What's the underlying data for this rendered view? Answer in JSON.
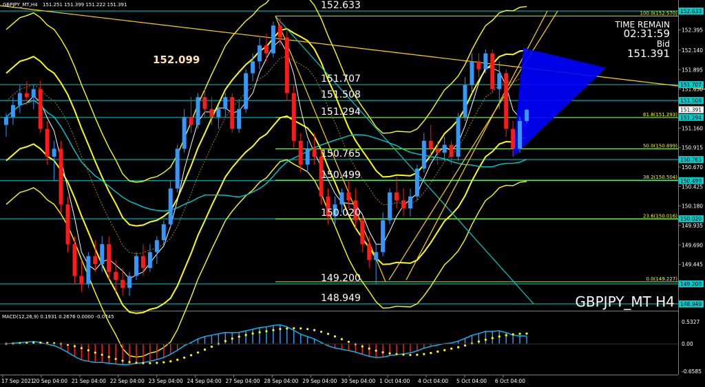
{
  "header": {
    "symbol_tf": "GBPJPY_MT,H4",
    "ohlc": "151.251 151.399 151.222 151.391"
  },
  "info": {
    "time_remain_label": "TIME REMAIN",
    "time_remain": "02:31:59",
    "bid_label": "Bid",
    "bid": "151.391",
    "watermark": "GBPJPY_MT H4",
    "note_value": "152.099"
  },
  "macd": {
    "label": "MACD(12,26,9) 0.1931 0.2676 0.0000 -0.0745",
    "ticks": [
      "0.5327",
      "0.00",
      "-0.6585"
    ],
    "tick_values": [
      0.5327,
      0.0,
      -0.6585
    ]
  },
  "time_labels": [
    "17 Sep 2021",
    "20 Sep 04:00",
    "21 Sep 04:00",
    "22 Sep 04:00",
    "23 Sep 04:00",
    "24 Sep 04:00",
    "27 Sep 04:00",
    "28 Sep 04:00",
    "29 Sep 04:00",
    "30 Sep 04:00",
    "1 Oct 04:00",
    "4 Oct 04:00",
    "5 Oct 04:00",
    "6 Oct 04:00"
  ],
  "price_axis": {
    "labels": [
      "152.395",
      "152.140",
      "151.895",
      "151.650",
      "151.405",
      "151.160",
      "150.915",
      "150.670",
      "150.425",
      "150.180",
      "149.935",
      "149.690",
      "149.445",
      "149.200"
    ],
    "box_labels": [
      "152.633",
      "151.707",
      "151.508",
      "151.391",
      "151.294",
      "150.765",
      "150.499",
      "150.020",
      "149.200",
      "148.949"
    ]
  },
  "levels": [
    {
      "price": 152.633,
      "label": "152.633"
    },
    {
      "price": 151.707,
      "label": "151.707"
    },
    {
      "price": 151.508,
      "label": "151.508"
    },
    {
      "price": 151.294,
      "label": "151.294"
    },
    {
      "price": 150.765,
      "label": "150.765"
    },
    {
      "price": 150.499,
      "label": "150.499"
    },
    {
      "price": 150.02,
      "label": "150.020"
    },
    {
      "price": 149.2,
      "label": "149.200"
    },
    {
      "price": 148.949,
      "label": "148.949"
    }
  ],
  "fib_levels": [
    {
      "price": 152.57,
      "label": "100.0(152.570)"
    },
    {
      "price": 151.293,
      "label": "61.8(151.293)"
    },
    {
      "price": 150.899,
      "label": "50.0(150.899)"
    },
    {
      "price": 150.504,
      "label": "38.2(150.504)"
    },
    {
      "price": 150.016,
      "label": "23.6(150.016)"
    },
    {
      "price": 149.227,
      "label": "0.0(149.227)"
    }
  ],
  "colors": {
    "background": "#000000",
    "bull": "#3399ff",
    "bear": "#ff1a1a",
    "band": "#ffff00",
    "level_line": "#00cccc",
    "fib_line": "#99ff33",
    "triangle": "#0000ff",
    "macd_signal": "#ffff00",
    "macd_line": "#00bfff"
  },
  "chart_data": {
    "type": "candlestick",
    "symbol": "GBPJPY_MT",
    "timeframe": "H4",
    "ylim": [
      148.949,
      152.633
    ],
    "candles": [
      [
        151.2,
        151.35,
        151.05,
        151.3
      ],
      [
        151.3,
        151.55,
        151.2,
        151.45
      ],
      [
        151.45,
        151.7,
        151.35,
        151.6
      ],
      [
        151.6,
        151.75,
        151.45,
        151.55
      ],
      [
        151.55,
        151.7,
        151.4,
        151.65
      ],
      [
        151.65,
        151.75,
        151.1,
        151.15
      ],
      [
        151.15,
        151.25,
        150.7,
        150.8
      ],
      [
        150.8,
        151.0,
        150.5,
        150.9
      ],
      [
        150.9,
        151.0,
        150.1,
        150.2
      ],
      [
        150.2,
        150.3,
        149.6,
        149.7
      ],
      [
        149.7,
        149.8,
        149.2,
        149.3
      ],
      [
        149.3,
        149.5,
        149.1,
        149.2
      ],
      [
        149.2,
        149.6,
        149.15,
        149.55
      ],
      [
        149.55,
        149.75,
        149.35,
        149.45
      ],
      [
        149.45,
        149.8,
        149.35,
        149.7
      ],
      [
        149.7,
        149.8,
        149.25,
        149.35
      ],
      [
        149.35,
        149.5,
        149.1,
        149.25
      ],
      [
        149.25,
        149.4,
        149.05,
        149.15
      ],
      [
        149.15,
        149.35,
        149.05,
        149.3
      ],
      [
        149.3,
        149.6,
        149.25,
        149.55
      ],
      [
        149.55,
        149.7,
        149.3,
        149.4
      ],
      [
        149.4,
        149.7,
        149.35,
        149.6
      ],
      [
        149.6,
        149.8,
        149.45,
        149.75
      ],
      [
        149.75,
        150.0,
        149.7,
        149.95
      ],
      [
        149.95,
        150.5,
        149.9,
        150.4
      ],
      [
        150.4,
        150.95,
        150.35,
        150.9
      ],
      [
        150.9,
        151.4,
        150.85,
        151.3
      ],
      [
        151.3,
        151.55,
        151.1,
        151.2
      ],
      [
        151.2,
        151.6,
        151.15,
        151.55
      ],
      [
        151.55,
        151.65,
        151.3,
        151.4
      ],
      [
        151.4,
        151.55,
        151.2,
        151.3
      ],
      [
        151.3,
        151.45,
        151.15,
        151.4
      ],
      [
        151.4,
        151.6,
        151.3,
        151.55
      ],
      [
        151.55,
        151.6,
        151.1,
        151.15
      ],
      [
        151.15,
        151.5,
        151.1,
        151.4
      ],
      [
        151.4,
        151.9,
        151.35,
        151.85
      ],
      [
        151.85,
        152.1,
        151.75,
        152.0
      ],
      [
        152.0,
        152.3,
        151.9,
        152.2
      ],
      [
        152.2,
        152.35,
        152.0,
        152.1
      ],
      [
        152.1,
        152.5,
        152.05,
        152.45
      ],
      [
        152.45,
        152.55,
        152.2,
        152.3
      ],
      [
        152.3,
        152.4,
        151.5,
        151.6
      ],
      [
        151.6,
        151.7,
        150.9,
        151.0
      ],
      [
        151.0,
        151.1,
        150.6,
        150.7
      ],
      [
        150.7,
        151.0,
        150.6,
        150.9
      ],
      [
        150.9,
        151.1,
        150.7,
        150.8
      ],
      [
        150.8,
        150.9,
        150.2,
        150.3
      ],
      [
        150.3,
        150.4,
        149.95,
        150.05
      ],
      [
        150.05,
        150.3,
        149.95,
        150.2
      ],
      [
        150.2,
        150.4,
        150.1,
        150.35
      ],
      [
        150.35,
        150.5,
        150.15,
        150.25
      ],
      [
        150.25,
        150.4,
        149.9,
        150.0
      ],
      [
        150.0,
        150.05,
        149.6,
        149.7
      ],
      [
        149.7,
        149.8,
        149.4,
        149.5
      ],
      [
        149.5,
        149.7,
        149.2,
        149.6
      ],
      [
        149.6,
        150.1,
        149.55,
        150.0
      ],
      [
        150.0,
        150.4,
        149.95,
        150.35
      ],
      [
        150.35,
        150.55,
        150.15,
        150.25
      ],
      [
        150.25,
        150.4,
        150.05,
        150.15
      ],
      [
        150.15,
        150.4,
        150.05,
        150.3
      ],
      [
        150.3,
        150.7,
        150.25,
        150.65
      ],
      [
        150.65,
        151.1,
        150.6,
        151.0
      ],
      [
        151.0,
        151.2,
        150.8,
        150.9
      ],
      [
        150.9,
        151.0,
        150.7,
        150.85
      ],
      [
        150.85,
        151.05,
        150.75,
        150.95
      ],
      [
        150.95,
        151.0,
        150.7,
        150.8
      ],
      [
        150.8,
        151.35,
        150.75,
        151.3
      ],
      [
        151.3,
        151.8,
        151.25,
        151.7
      ],
      [
        151.7,
        152.1,
        151.6,
        152.0
      ],
      [
        152.0,
        152.1,
        151.8,
        151.9
      ],
      [
        151.9,
        152.15,
        151.85,
        152.1
      ],
      [
        152.1,
        152.15,
        151.6,
        151.65
      ],
      [
        151.65,
        152.0,
        151.4,
        151.85
      ],
      [
        151.85,
        151.9,
        151.05,
        151.15
      ],
      [
        151.15,
        151.25,
        150.8,
        150.9
      ],
      [
        150.9,
        151.3,
        150.85,
        151.25
      ],
      [
        151.25,
        151.4,
        151.22,
        151.391
      ]
    ]
  }
}
